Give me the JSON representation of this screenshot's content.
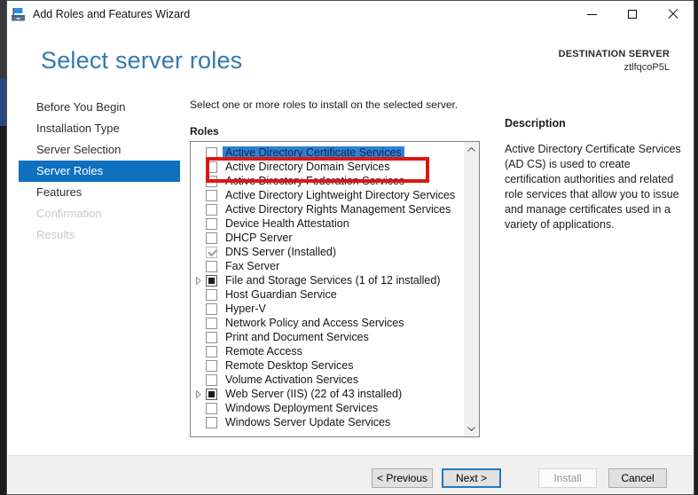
{
  "window": {
    "title": "Add Roles and Features Wizard",
    "controls": {
      "minimize": "minimize-icon",
      "maximize": "maximize-icon",
      "close": "close-icon"
    }
  },
  "header": {
    "title": "Select server roles",
    "destination_label": "DESTINATION SERVER",
    "destination_server": "ztlfqcoP5L"
  },
  "sidebar": {
    "items": [
      {
        "label": "Before You Begin",
        "state": "normal"
      },
      {
        "label": "Installation Type",
        "state": "normal"
      },
      {
        "label": "Server Selection",
        "state": "normal"
      },
      {
        "label": "Server Roles",
        "state": "selected"
      },
      {
        "label": "Features",
        "state": "normal"
      },
      {
        "label": "Confirmation",
        "state": "disabled"
      },
      {
        "label": "Results",
        "state": "disabled"
      }
    ]
  },
  "main": {
    "instruction": "Select one or more roles to install on the selected server.",
    "roles_label": "Roles",
    "roles": [
      {
        "label": "Active Directory Certificate Services",
        "checkbox": "unchecked",
        "selected": true,
        "expandable": false
      },
      {
        "label": "Active Directory Domain Services",
        "checkbox": "unchecked",
        "selected": false,
        "expandable": false,
        "annotated": true
      },
      {
        "label": "Active Directory Federation Services",
        "checkbox": "unchecked",
        "selected": false,
        "expandable": false
      },
      {
        "label": "Active Directory Lightweight Directory Services",
        "checkbox": "unchecked",
        "selected": false,
        "expandable": false
      },
      {
        "label": "Active Directory Rights Management Services",
        "checkbox": "unchecked",
        "selected": false,
        "expandable": false
      },
      {
        "label": "Device Health Attestation",
        "checkbox": "unchecked",
        "selected": false,
        "expandable": false
      },
      {
        "label": "DHCP Server",
        "checkbox": "unchecked",
        "selected": false,
        "expandable": false
      },
      {
        "label": "DNS Server (Installed)",
        "checkbox": "checked-disabled",
        "selected": false,
        "expandable": false
      },
      {
        "label": "Fax Server",
        "checkbox": "unchecked",
        "selected": false,
        "expandable": false
      },
      {
        "label": "File and Storage Services (1 of 12 installed)",
        "checkbox": "indeterminate",
        "selected": false,
        "expandable": true
      },
      {
        "label": "Host Guardian Service",
        "checkbox": "unchecked",
        "selected": false,
        "expandable": false
      },
      {
        "label": "Hyper-V",
        "checkbox": "unchecked",
        "selected": false,
        "expandable": false
      },
      {
        "label": "Network Policy and Access Services",
        "checkbox": "unchecked",
        "selected": false,
        "expandable": false
      },
      {
        "label": "Print and Document Services",
        "checkbox": "unchecked",
        "selected": false,
        "expandable": false
      },
      {
        "label": "Remote Access",
        "checkbox": "unchecked",
        "selected": false,
        "expandable": false
      },
      {
        "label": "Remote Desktop Services",
        "checkbox": "unchecked",
        "selected": false,
        "expandable": false
      },
      {
        "label": "Volume Activation Services",
        "checkbox": "unchecked",
        "selected": false,
        "expandable": false
      },
      {
        "label": "Web Server (IIS) (22 of 43 installed)",
        "checkbox": "indeterminate",
        "selected": false,
        "expandable": true
      },
      {
        "label": "Windows Deployment Services",
        "checkbox": "unchecked",
        "selected": false,
        "expandable": false
      },
      {
        "label": "Windows Server Update Services",
        "checkbox": "unchecked",
        "selected": false,
        "expandable": false
      }
    ]
  },
  "description": {
    "title": "Description",
    "text": "Active Directory Certificate Services (AD CS) is used to create certification authorities and related role services that allow you to issue and manage certificates used in a variety of applications."
  },
  "footer": {
    "buttons": [
      {
        "key": "previous",
        "label": "< Previous",
        "state": "normal"
      },
      {
        "key": "next",
        "label": "Next >",
        "state": "default"
      },
      {
        "key": "install",
        "label": "Install",
        "state": "disabled"
      },
      {
        "key": "cancel",
        "label": "Cancel",
        "state": "normal"
      }
    ]
  },
  "icons": {
    "app": "roles-wizard-toolbox-icon",
    "scroll_up": "chevron-up-icon",
    "scroll_down": "chevron-down-icon",
    "expander": "expand-triangle-icon",
    "checked": "gray-checkmark-icon",
    "indeterminate": "filled-square-icon"
  },
  "colors": {
    "sidebar_selected": "#1070c0",
    "list_selection": "#2f80d5",
    "annotation_red": "#de1614",
    "heading_blue": "#3279b2",
    "default_button_border": "#2678c0",
    "footer_background": "#f0f0f0"
  }
}
